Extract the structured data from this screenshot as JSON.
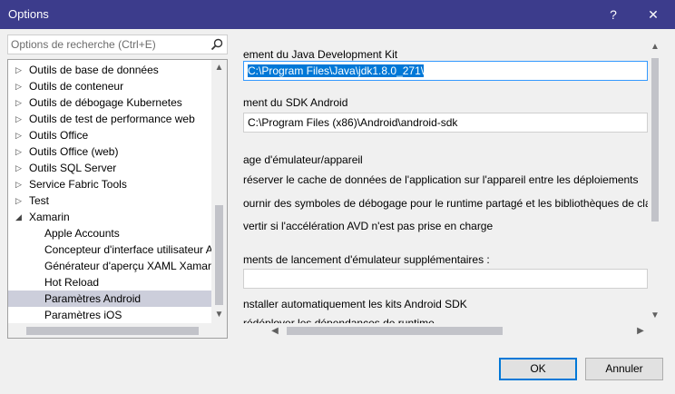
{
  "window": {
    "title": "Options",
    "help_label": "?",
    "close_label": "✕"
  },
  "search": {
    "placeholder": "Options de recherche (Ctrl+E)"
  },
  "tree": {
    "items": [
      {
        "label": "Outils de base de données",
        "expandable": true
      },
      {
        "label": "Outils de conteneur",
        "expandable": true
      },
      {
        "label": "Outils de débogage Kubernetes",
        "expandable": true
      },
      {
        "label": "Outils de test de performance web",
        "expandable": true
      },
      {
        "label": "Outils Office",
        "expandable": true
      },
      {
        "label": "Outils Office (web)",
        "expandable": true
      },
      {
        "label": "Outils SQL Server",
        "expandable": true
      },
      {
        "label": "Service Fabric Tools",
        "expandable": true
      },
      {
        "label": "Test",
        "expandable": true
      },
      {
        "label": "Xamarin",
        "expanded": true
      },
      {
        "label": "Apple Accounts"
      },
      {
        "label": "Concepteur d'interface utilisateur A"
      },
      {
        "label": "Générateur d'aperçu XAML Xamari"
      },
      {
        "label": "Hot Reload"
      },
      {
        "label": "Paramètres Android",
        "selected": true
      },
      {
        "label": "Paramètres iOS"
      }
    ]
  },
  "panel": {
    "jdk_label": "ement du Java Development Kit",
    "jdk_value": "C:\\Program Files\\Java\\jdk1.8.0_271\\",
    "sdk_label": "ment du SDK Android",
    "sdk_value": "C:\\Program Files (x86)\\Android\\android-sdk",
    "emulator_header": "age d'émulateur/appareil",
    "opt_preserve": "réserver le cache de données de l'application sur l'appareil entre les déploiements",
    "opt_symbols": "ournir des symboles de débogage pour le runtime partagé et les bibliothèques de cla",
    "opt_avd": "vertir si l'accélération AVD n'est pas prise en charge",
    "args_label": "ments de lancement d'émulateur supplémentaires :",
    "args_value": "",
    "opt_install_sdk": "nstaller automatiquement les kits Android SDK",
    "opt_redeploy": "rédéployer les dépendances de runtime"
  },
  "buttons": {
    "ok": "OK",
    "cancel": "Annuler"
  },
  "colors": {
    "titlebar": "#3c3c8c",
    "selection": "#0078d7",
    "tree_selected": "#cccedb"
  }
}
